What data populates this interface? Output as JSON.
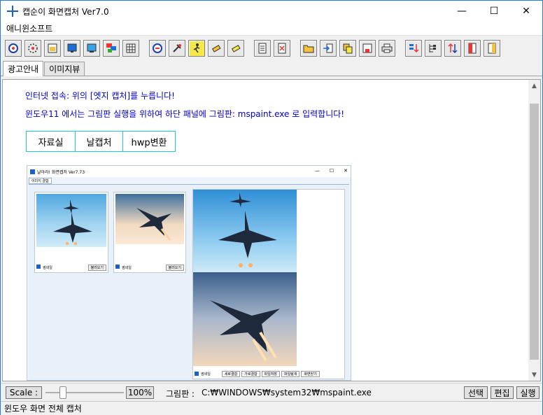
{
  "window": {
    "title": "캡순이 화면캡처 Ver7.0",
    "minimize": "—",
    "maximize": "☐",
    "close": "✕"
  },
  "menu": {
    "items": [
      "애니윈소프트"
    ]
  },
  "toolbar": {
    "buttons": [
      "capture-fullscreen-icon",
      "capture-region-icon",
      "capture-window-icon",
      "capture-monitor-icon",
      "capture-screen-icon",
      "capture-multi-icon",
      "capture-grid-icon",
      "scroll-capture-icon",
      "settings-tools-icon",
      "run-icon",
      "eraser-icon",
      "eraser2-icon",
      "document-icon",
      "document-delete-icon",
      "open-folder-icon",
      "import-icon",
      "copy-icon",
      "save-icon",
      "print-icon",
      "sort-down-icon",
      "tree-icon",
      "swap-updown-icon",
      "page-left-icon",
      "page-right-icon"
    ]
  },
  "tabs": [
    "광고안내",
    "이미지뷰"
  ],
  "content": {
    "line1": "인터넷 접속: 위의 [엣지 캡처]를 누릅니다!",
    "line2": "윈도우11 에서는 그림판 실행을 위하여 하단 패널에 그림판: mspaint.exe 로 입력합니다!",
    "links": [
      "자료실",
      "날캡처",
      "hwp변환"
    ]
  },
  "screenshot": {
    "title": "날아라! 화면캡처 Ver7.73",
    "tab": "이미지 결합",
    "min": "—",
    "max": "☐",
    "close": "✕",
    "card1_check": "썸네일",
    "card1_btn": "불러오기",
    "card2_check": "썸네일",
    "card2_btn": "불러오기",
    "right_check": "썸네일",
    "right_buttons": [
      "세로결합",
      "가로결합",
      "파일저장",
      "파일탐색",
      "화면닫기"
    ]
  },
  "bottom": {
    "scale_label": "Scale :",
    "scale_value": "100%",
    "paint_label": "그림판 :",
    "paint_path": "C:₩WINDOWS₩system32₩mspaint.exe",
    "btn_select": "선택",
    "btn_edit": "편집",
    "btn_run": "실행",
    "scale_percent": 100
  },
  "status": {
    "text": "윈도우 화면 전체 캡처"
  }
}
